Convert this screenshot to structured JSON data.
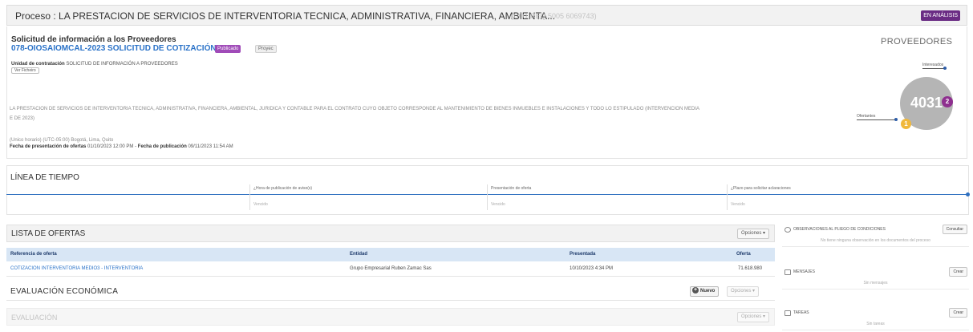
{
  "header": {
    "process_title": "Proceso : LA PRESTACION DE SERVICIOS DE INTERVENTORIA TECNICA, ADMINISTRATIVA, FINANCIERA, AMBIENTA...",
    "process_id": "(CO1.REQ.5005 6069743)",
    "status_badge": "EN ANÁLISIS",
    "colors": {
      "status": "#6a2c84",
      "link": "#2a72c8",
      "accent": "#2e6fc0"
    }
  },
  "solicitud": {
    "title": "Solicitud de información a los Proveedores",
    "code": "078-OIOSAIOMCAL-2023 SOLICITUD DE COTIZACIÓN",
    "badge_published": "Publicado",
    "badge_project": "Proyec",
    "unit_label": "Unidad de contratación",
    "unit_value": "SOLICITUD DE INFORMACIÓN A PROVEEDORES",
    "unit_tag": "Ver Ficheiro",
    "description": "LA PRESTACION DE SERVICIOS DE INTERVENTORIA TECNICA, ADMINISTRATIVA, FINANCIERA, AMBIENTAL, JURIDICA Y CONTABLE PARA EL CONTRATO CUYO OBJETO CORRESPONDE AL MANTENIMIENTO DE BIENES INMUEBLES E INSTALACIONES Y TODO LO ESTIPULADO (INTERVENCION MEDIA E DE 2023)",
    "zone": "(Unico horario) (UTC-05:00) Bogotá, Lima, Quito",
    "presentation_label": "Fecha de presentación de ofertas",
    "presentation_value": "01/10/2023 12:00 PM",
    "publication_label": "Fecha de publicación",
    "publication_value": "09/11/2023 11:54 AM"
  },
  "proveedores": {
    "title": "PROVEEDORES",
    "total": "4031",
    "interesados_label": "Interesados",
    "interesados_count": "2",
    "ofertantes_label": "Ofertantes",
    "ofertantes_count": "1",
    "colors": {
      "interesados": "#8e2f8f",
      "ofertantes": "#f0b83c",
      "total": "#b5b5b5"
    }
  },
  "timeline": {
    "title": "LÍNEA DE TIEMPO",
    "steps": [
      {
        "label": "¿Hora de publicación de aviso(s)",
        "value": "Vencido"
      },
      {
        "label": "Presentación de oferta",
        "value": "Vencido"
      },
      {
        "label": "¿Plazo para solicitar aclaraciones",
        "value": "Vencido"
      }
    ]
  },
  "offers": {
    "title": "LISTA DE OFERTAS",
    "options_label": "Opciones ▾",
    "columns": [
      "Referencia de oferta",
      "Entidad",
      "Presentada",
      "Oferta"
    ],
    "rows": [
      {
        "reference": "COTIZACION INTERVENTORIA MEDIO3 - INTERVENTORIA",
        "entity": "Grupo Empresarial Ruben Zamac Sas",
        "presented": "10/10/2023 4:34 PM",
        "offer": "71.618.980"
      }
    ]
  },
  "evaluacion_economica": {
    "title": "EVALUACIÓN ECONÓMICA",
    "new_label": "Nuevo",
    "options_label": "Opciones ▾"
  },
  "evaluacion": {
    "title": "EVALUACIÓN",
    "options_label": "Opciones ▾"
  },
  "side": [
    {
      "title": "OBSERVACIONES AL PLIEGO DE CONDICIONES",
      "button": "Consultar",
      "empty": "No tiene ninguna observación en los documentos del proceso"
    },
    {
      "title": "MENSAJES",
      "button": "Crear",
      "empty": "Sin mensajes"
    },
    {
      "title": "TAREAS",
      "button": "Crear",
      "empty": "Sin tareas"
    }
  ]
}
